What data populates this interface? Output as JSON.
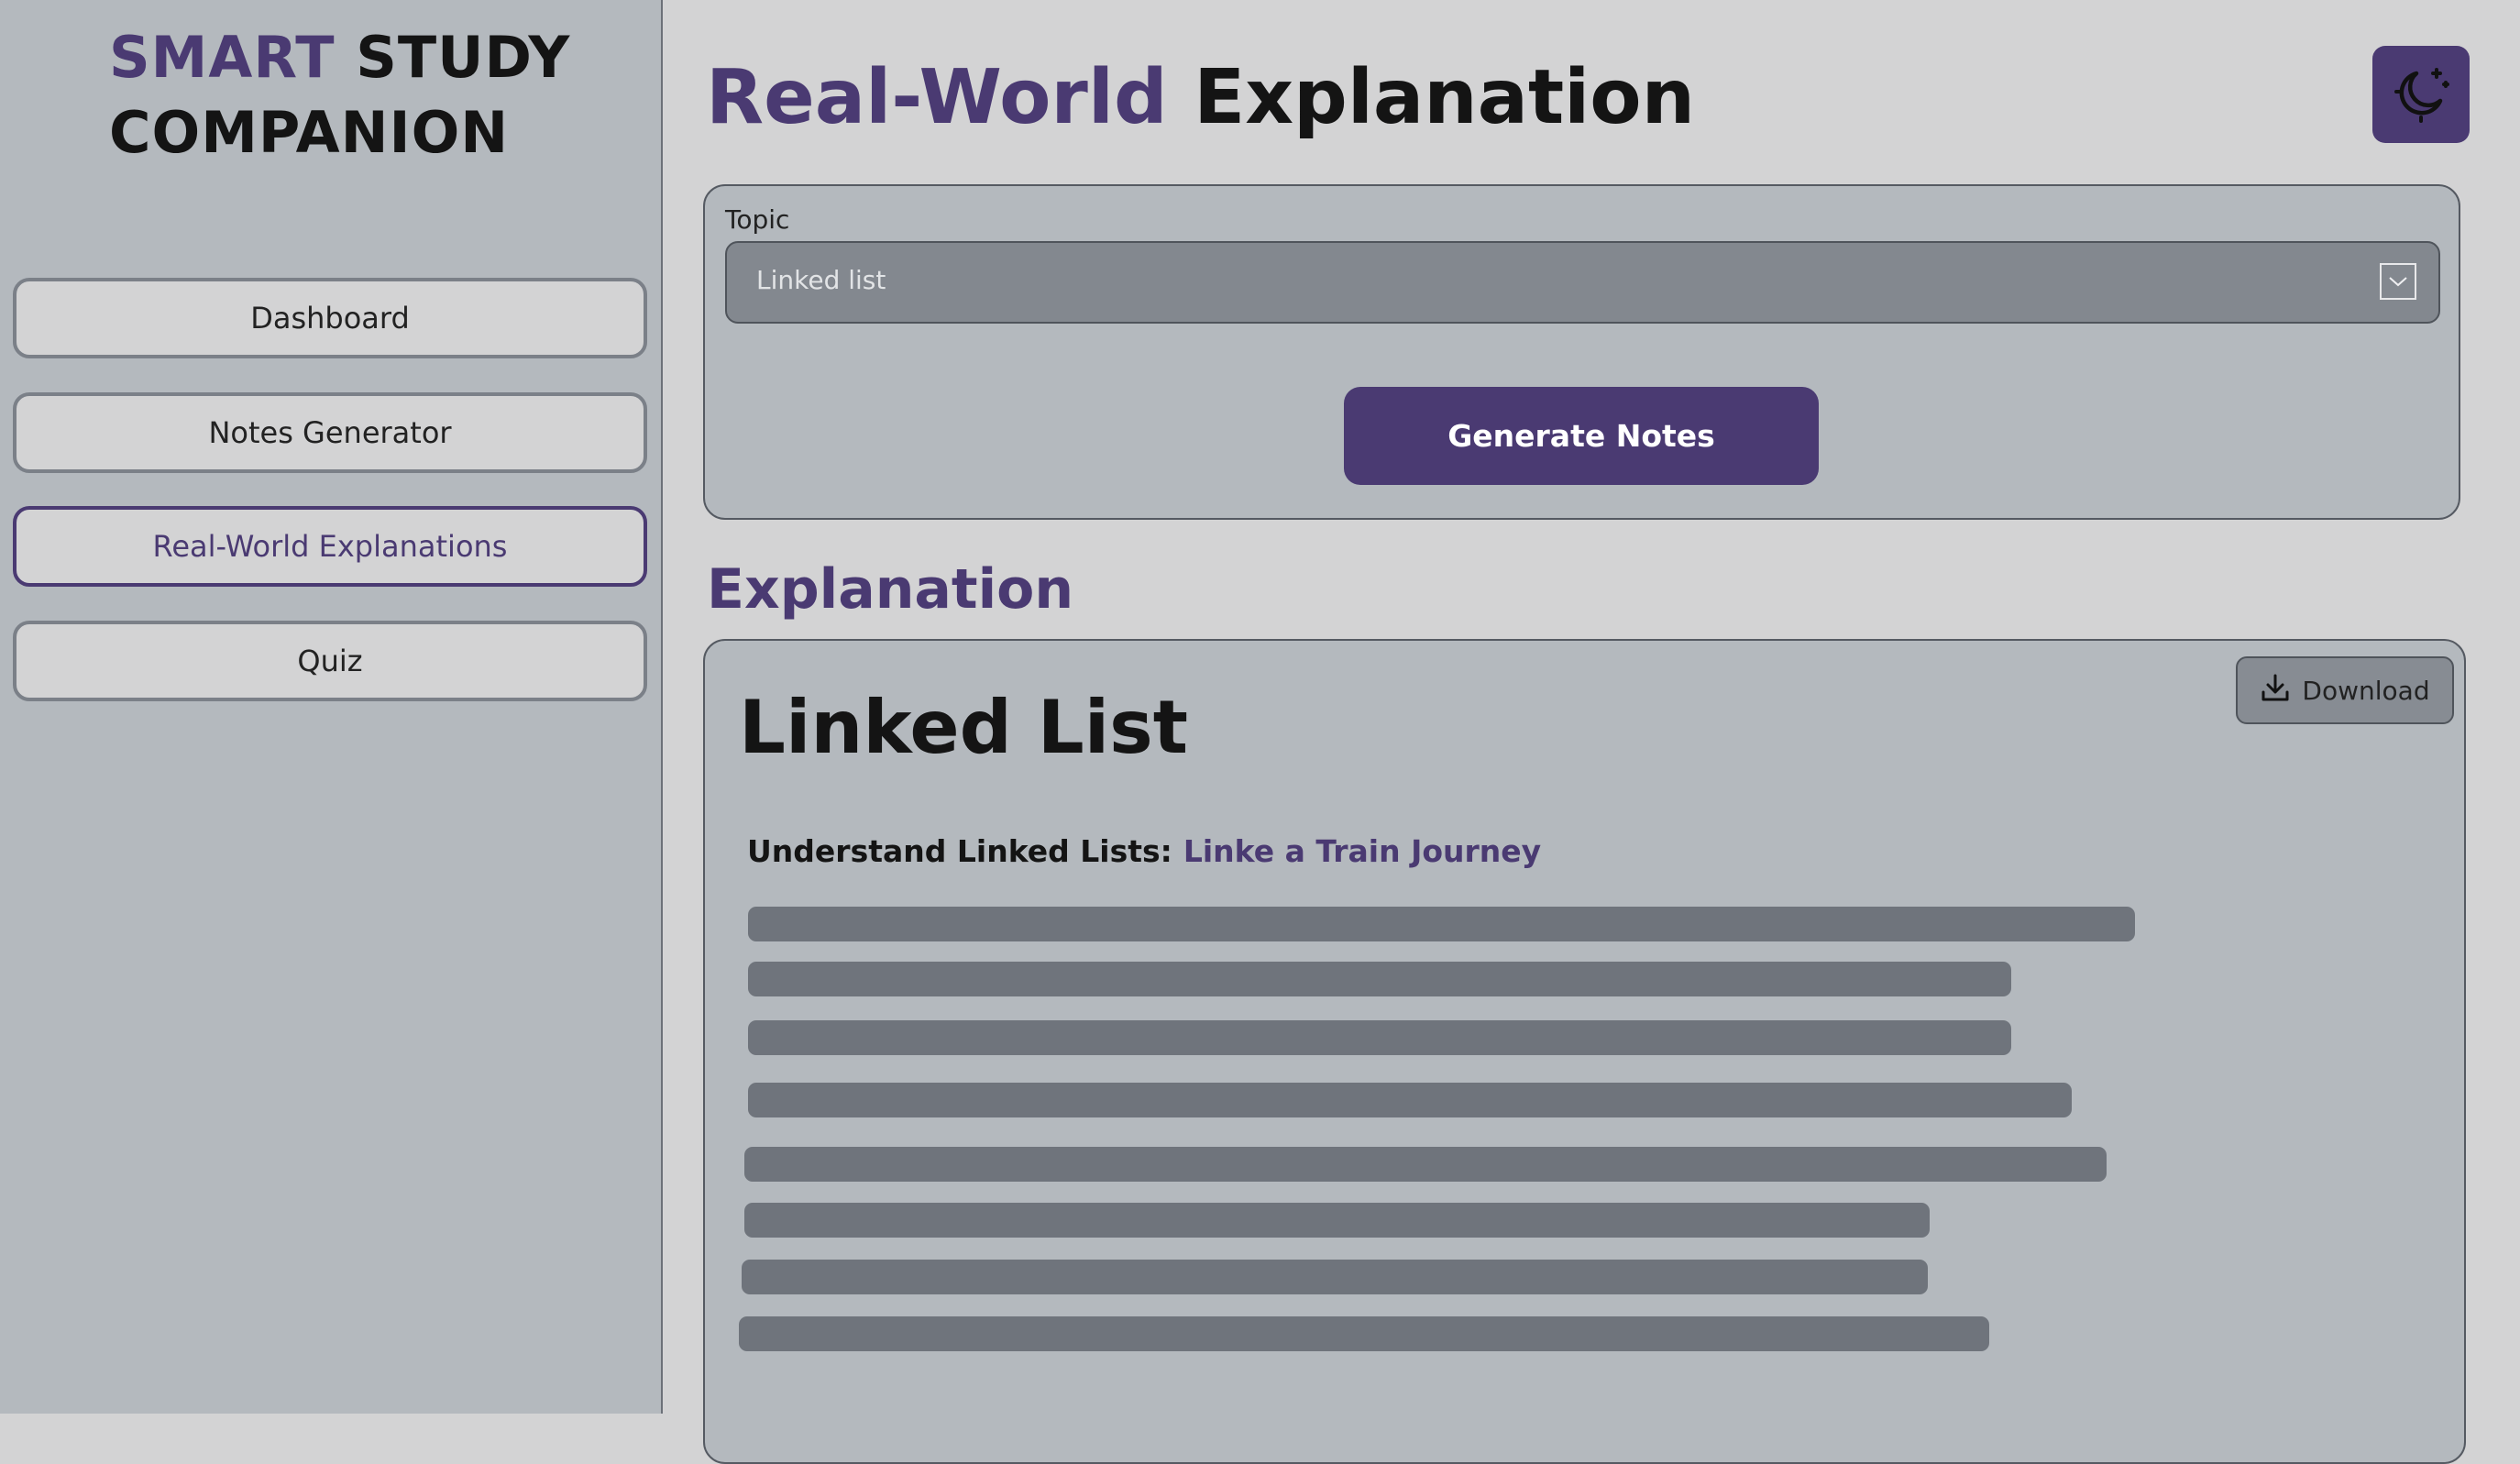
{
  "sidebar": {
    "logo": {
      "word1": "SMART",
      "word2": "STUDY",
      "word3": "COMPANION"
    },
    "items": [
      {
        "label": "Dashboard"
      },
      {
        "label": "Notes Generator"
      },
      {
        "label": "Real-World Explanations"
      },
      {
        "label": "Quiz"
      }
    ],
    "active_index": 2
  },
  "header": {
    "title_accent": "Real-World",
    "title_rest": "Explanation",
    "theme_icon": "moon-icon"
  },
  "topic_form": {
    "label": "Topic",
    "selected": "Linked list",
    "dropdown_icon": "chevron-down-icon",
    "generate_label": "Generate Notes"
  },
  "explanation": {
    "section_title": "Explanation",
    "download_label": "Download",
    "download_icon": "download-icon",
    "heading": "Linked List",
    "subtitle_key": "Understand Linked Lists:",
    "subtitle_value": "Linke a Train Journey"
  },
  "colors": {
    "accent": "#4a3a72",
    "sidebar_bg": "#b4b9be",
    "page_bg": "#d3d3d4",
    "placeholder_line": "#6f747c"
  }
}
